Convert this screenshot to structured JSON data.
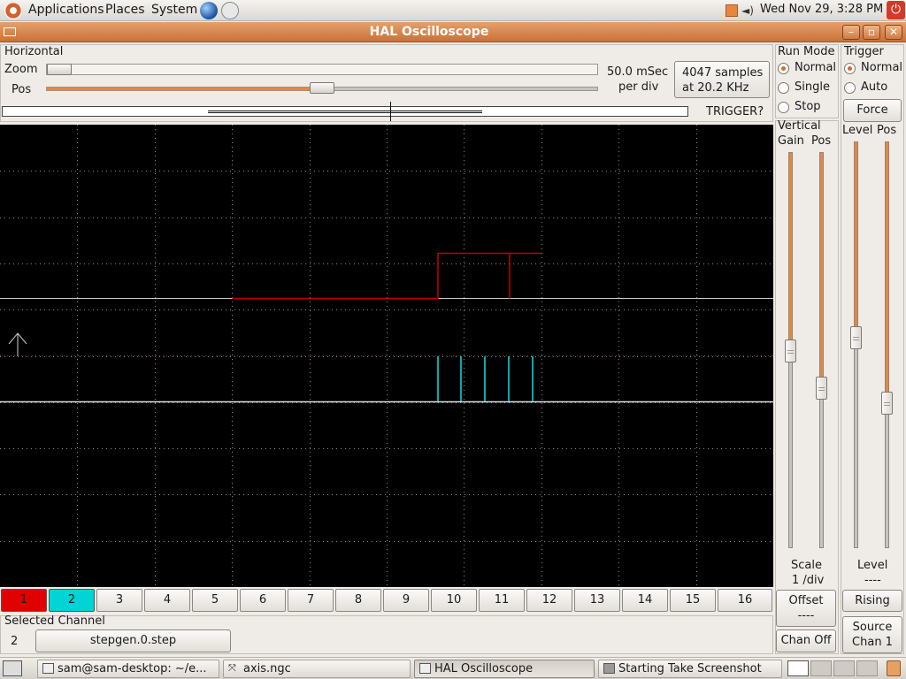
{
  "top_panel": {
    "menus": [
      "Applications",
      "Places",
      "System"
    ],
    "clock": "Wed Nov 29,  3:28 PM"
  },
  "window": {
    "title": "HAL Oscilloscope"
  },
  "horizontal": {
    "section_label": "Horizontal",
    "zoom_label": "Zoom",
    "pos_label": "Pos",
    "zoom_value": 0.0,
    "pos_value": 0.5,
    "rate_line1": "50.0 mSec",
    "rate_line2": "per div",
    "samples_line1": "4047 samples",
    "samples_line2": "at 20.2 KHz",
    "trigger_status": "TRIGGER?"
  },
  "run_mode": {
    "label": "Run Mode",
    "options": [
      "Normal",
      "Single",
      "Stop"
    ],
    "selected": "Normal"
  },
  "trigger": {
    "label": "Trigger",
    "options": [
      "Normal",
      "Auto"
    ],
    "selected": "Normal",
    "force_label": "Force",
    "level_label": "Level",
    "pos_label": "Pos",
    "level_value": 0.52,
    "pos_value": 0.35,
    "level_text_label": "Level",
    "level_text_value": "----",
    "edge_button": "Rising",
    "source_label": "Source",
    "source_value": "Chan  1"
  },
  "vertical": {
    "label": "Vertical",
    "gain_label": "Gain",
    "pos_label": "Pos",
    "gain_value": 0.5,
    "pos_value": 0.4,
    "scale_label": "Scale",
    "scale_value": "1 /div",
    "offset_label": "Offset",
    "offset_value": "----",
    "chan_off_label": "Chan Off"
  },
  "channels": {
    "labels": [
      "1",
      "2",
      "3",
      "4",
      "5",
      "6",
      "7",
      "8",
      "9",
      "10",
      "11",
      "12",
      "13",
      "14",
      "15",
      "16"
    ],
    "colors": {
      "1": "#e00000",
      "2": "#00d4d4"
    },
    "selected_label": "Selected Channel",
    "selected_number": "2",
    "selected_name": "stepgen.0.step"
  },
  "colors": {
    "accent": "#e8863f",
    "scope_bg": "#000000",
    "trace_ch1": "#c00000",
    "trace_ch2": "#00e5e5",
    "grid": "#8a8a8a"
  },
  "taskbar": {
    "tasks": [
      "sam@sam-desktop: ~/e...",
      "axis.ngc",
      "HAL Oscilloscope",
      "Starting Take Screenshot"
    ]
  }
}
